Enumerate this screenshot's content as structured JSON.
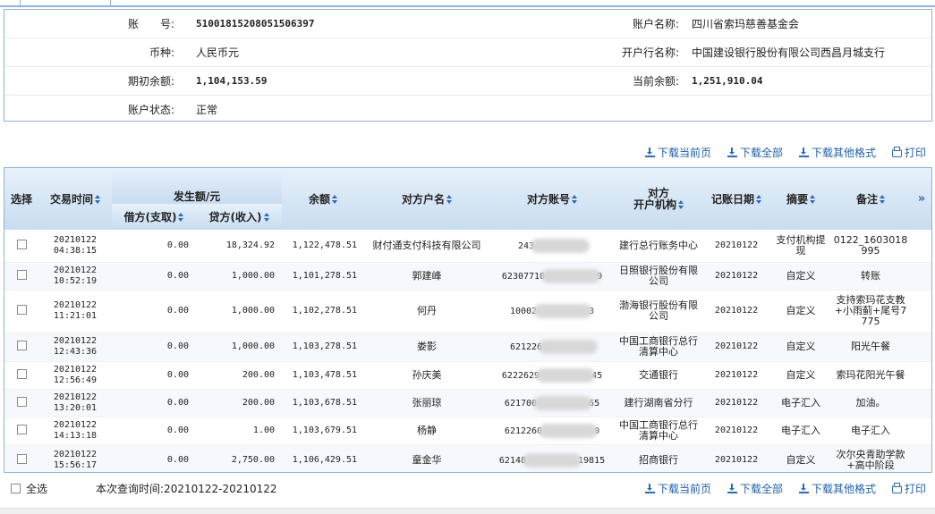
{
  "account": {
    "number_label": "账　　号:",
    "number": "510018152080515063​97",
    "name_label": "账户名称:",
    "name": "四川省索玛慈善基金会",
    "currency_label": "币种:",
    "currency": "人民币元",
    "bank_label": "开户行名称:",
    "bank": "中国建设银行股份有限公司西昌月城支行",
    "opening_label": "期初余额:",
    "opening": "1,104,153.59",
    "current_label": "当前余额:",
    "current": "1,251,910.04",
    "status_label": "账户状态:",
    "status": "正常"
  },
  "toolbar": {
    "download_page": "下载当前页",
    "download_all": "下载全部",
    "download_other": "下载其他格式",
    "print": "打印"
  },
  "table": {
    "headers": {
      "select": "选择",
      "time": "交易时间",
      "amount_group": "发生额/元",
      "debit": "借方(支取)",
      "credit": "贷方(收入)",
      "balance": "余额",
      "counterparty_name": "对方户名",
      "counterparty_account": "对方账号",
      "counterparty_bank": "对方\n开户机构",
      "post_date": "记账日期",
      "summary": "摘要",
      "remark": "备注",
      "more": "»"
    },
    "rows": [
      {
        "date": "20210122",
        "time": "04:38:15",
        "debit": "0.00",
        "credit": "18,324.92",
        "balance": "1,122,478.51",
        "name": "财付通支付科技有限公司",
        "acct_a": "243",
        "acct_b": "",
        "bank": "建行总行账务中心",
        "post": "20210122",
        "summary": "支付机构提现",
        "remark": "0122_1603018995"
      },
      {
        "date": "20210122",
        "time": "10:52:19",
        "debit": "0.00",
        "credit": "1,000.00",
        "balance": "1,101,278.51",
        "name": "郭建峰",
        "acct_a": "623077​10",
        "acct_b": "9",
        "bank": "日照银行股份有限公司",
        "post": "20210122",
        "summary": "自定义",
        "remark": "转账"
      },
      {
        "date": "20210122",
        "time": "11:21:01",
        "debit": "0.00",
        "credit": "1,000.00",
        "balance": "1,102,278.51",
        "name": "何丹",
        "acct_a": "10002",
        "acct_b": "3",
        "bank": "渤海银行股份有限公司",
        "post": "20210122",
        "summary": "自定义",
        "remark": "支持索玛花支教+小雨蓟+尾号7775"
      },
      {
        "date": "20210122",
        "time": "12:43:36",
        "debit": "0.00",
        "credit": "1,000.00",
        "balance": "1,103,278.51",
        "name": "娄影",
        "acct_a": "621226",
        "acct_b": "",
        "bank": "中国工商银行总行清算中心",
        "post": "20210122",
        "summary": "自定义",
        "remark": "阳光午餐"
      },
      {
        "date": "20210122",
        "time": "12:56:49",
        "debit": "0.00",
        "credit": "200.00",
        "balance": "1,103,478.51",
        "name": "孙庆美",
        "acct_a": "6222629",
        "acct_b": "45",
        "bank": "交通银行",
        "post": "20210122",
        "summary": "自定义",
        "remark": "索玛花阳光午餐"
      },
      {
        "date": "20210122",
        "time": "13:20:01",
        "debit": "0.00",
        "credit": "200.00",
        "balance": "1,103,678.51",
        "name": "张丽琼",
        "acct_a": "621700",
        "acct_b": "65",
        "bank": "建行湖南省分行",
        "post": "20210122",
        "summary": "电子汇入",
        "remark": "加油。"
      },
      {
        "date": "20210122",
        "time": "14:13:18",
        "debit": "0.00",
        "credit": "1.00",
        "balance": "1,103,679.51",
        "name": "杨静",
        "acct_a": "6212260",
        "acct_b": "0",
        "bank": "中国工商银行总行清算中心",
        "post": "20210122",
        "summary": "电子汇入",
        "remark": "电子汇入"
      },
      {
        "date": "20210122",
        "time": "15:56:17",
        "debit": "0.00",
        "credit": "2,750.00",
        "balance": "1,106,429.51",
        "name": "童金华",
        "acct_a": "62148",
        "acct_b": "19815",
        "bank": "招商银行",
        "post": "20210122",
        "summary": "自定义",
        "remark": "次尔央青助学款+高中阶段"
      }
    ]
  },
  "footer": {
    "select_all": "全选",
    "query_time": "本次查询时间:20210122-20210122"
  },
  "colors": {
    "border": "#8fb3d9",
    "link": "#1f5fa8",
    "header_bg": "#c8dcf0"
  }
}
